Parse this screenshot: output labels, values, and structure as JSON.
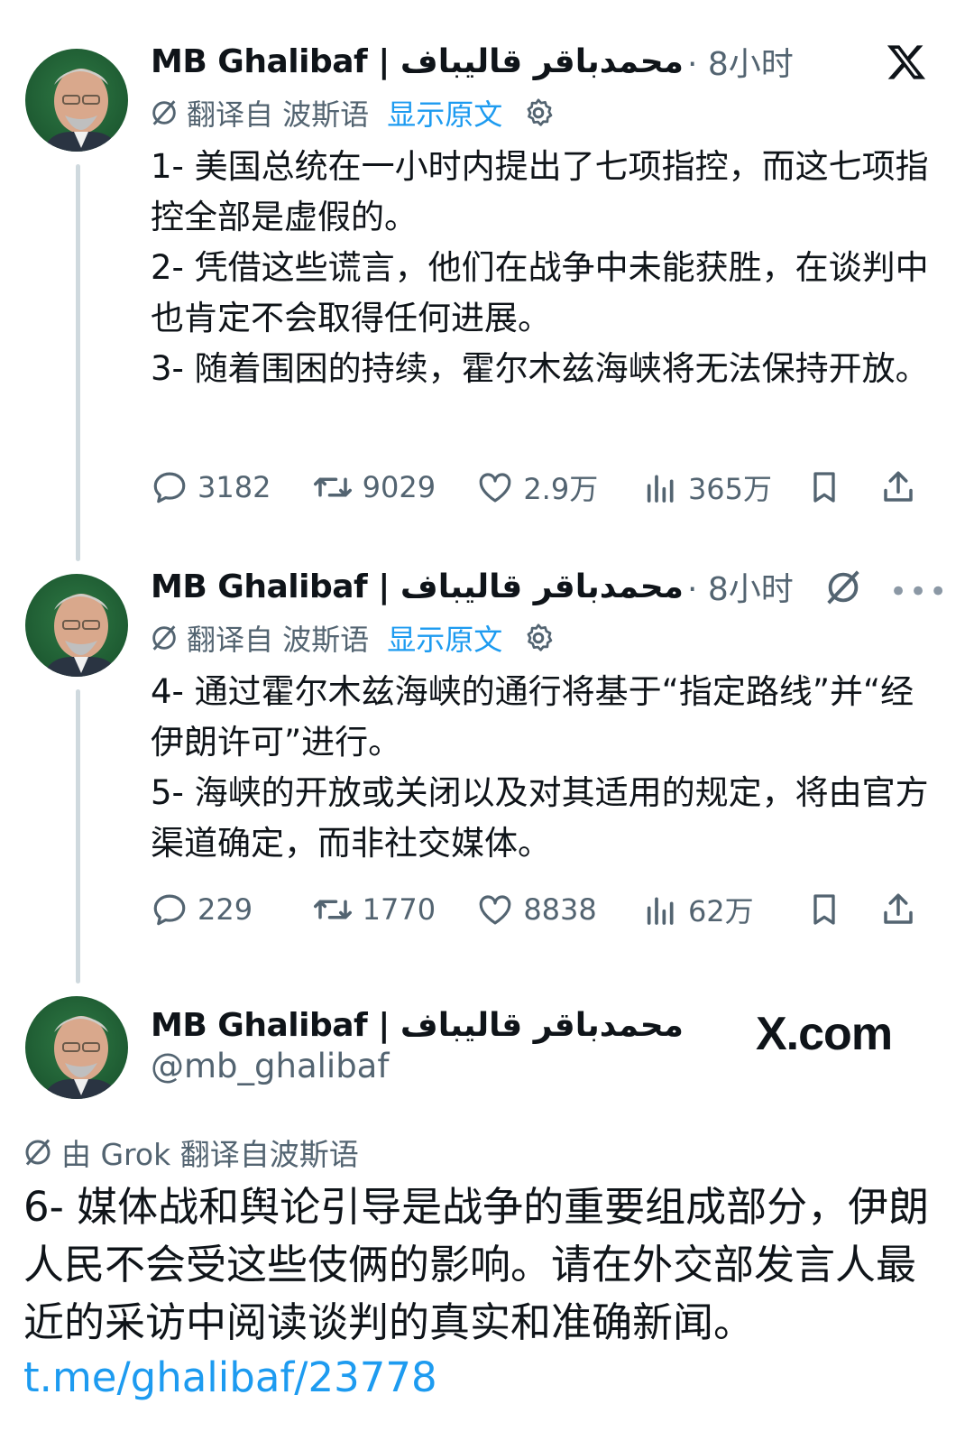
{
  "author": {
    "display_name": "MB Ghalibaf | محمدباقر قالیباف",
    "handle": "@mb_ghalibaf"
  },
  "tweets": [
    {
      "time": "· 8小时",
      "translated_from": "翻译自 波斯语",
      "show_original": "显示原文",
      "paragraphs": [
        "1- 美国总统在一小时内提出了七项指控，而这七项指控全部是虚假的。",
        "2- 凭借这些谎言，他们在战争中未能获胜，在谈判中也肯定不会取得任何进展。",
        "3- 随着围困的持续，霍尔木兹海峡将无法保持开放。"
      ],
      "replies": "3182",
      "reposts": "9029",
      "likes": "2.9万",
      "views": "365万"
    },
    {
      "time": "· 8小时",
      "translated_from": "翻译自 波斯语",
      "show_original": "显示原文",
      "paragraphs": [
        "4- 通过霍尔木兹海峡的通行将基于“指定路线”并“经伊朗许可”进行。",
        "5- 海峡的开放或关闭以及对其适用的规定，将由官方渠道确定，而非社交媒体。"
      ],
      "replies": "229",
      "reposts": "1770",
      "likes": "8838",
      "views": "62万"
    }
  ],
  "final_post": {
    "site_logo": "X.com",
    "grok_note": "由 Grok 翻译自波斯语",
    "text": "6- 媒体战和舆论引导是战争的重要组成部分，伊朗人民不会受这些伎俩的影响。请在外交部发言人最近的采访中阅读谈判的真实和准确新闻。",
    "link": "t.me/ghalibaf/23778"
  },
  "icons": {
    "x_logo": "x-logo-icon",
    "translate": "translate-icon",
    "gear": "gear-icon",
    "reply": "reply-icon",
    "repost": "repost-icon",
    "like": "heart-icon",
    "views": "views-icon",
    "bookmark": "bookmark-icon",
    "share": "share-icon",
    "more": "more-icon"
  },
  "colors": {
    "text": "#0f1419",
    "muted": "#536471",
    "link": "#1d9bf0",
    "thread_line": "#cfd9de"
  }
}
